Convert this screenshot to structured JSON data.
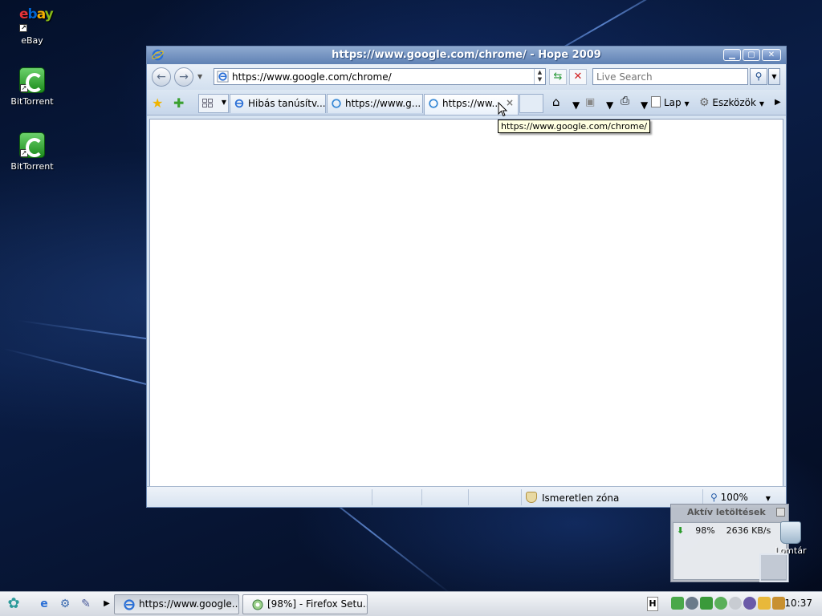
{
  "desktop": {
    "icons": [
      {
        "label": "eBay"
      },
      {
        "label": "BitTorrent"
      },
      {
        "label": "BitTorrent"
      }
    ],
    "trash_label": "Lomtár"
  },
  "window": {
    "title": "https://www.google.com/chrome/ - Hope 2009",
    "address": "https://www.google.com/chrome/",
    "search_placeholder": "Live Search",
    "tabs": [
      {
        "label": "Hibás tanúsítv..."
      },
      {
        "label": "https://www.g..."
      },
      {
        "label": "https://ww..."
      }
    ],
    "tab_close": "×",
    "commands": {
      "page": "Lap",
      "tools": "Eszközök"
    },
    "tooltip": "https://www.google.com/chrome/",
    "status": {
      "zone": "Ismeretlen zóna",
      "zoom": "100%"
    }
  },
  "downloads": {
    "title": "Aktív letöltések",
    "percent": "98%",
    "speed": "2636 KB/s"
  },
  "taskbar": {
    "tasks": [
      {
        "label": "https://www.google..."
      },
      {
        "label": "[98%] - Firefox Setu..."
      }
    ],
    "lang": "H",
    "clock": "10:37"
  },
  "colors": {
    "accent": "#5f81b4",
    "tooltip_bg": "#ffffe1"
  }
}
